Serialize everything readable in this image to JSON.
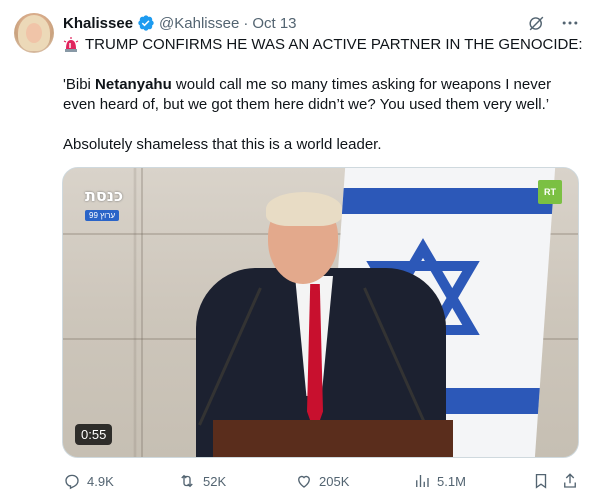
{
  "author": {
    "name": "Khalissee",
    "handle": "@Kahlissee",
    "separator": "·",
    "date": "Oct 13"
  },
  "tweet": {
    "headline": "TRUMP CONFIRMS HE WAS AN ACTIVE PARTNER IN THE GENOCIDE:",
    "quote_pre": "'Bibi ",
    "quote_bold": "Netanyahu",
    "quote_post": " would call me so many times asking for weapons I never even heard of, but we got them here didn’t we? You used them very well.’",
    "comment": "Absolutely shameless that this is a world leader."
  },
  "media": {
    "duration": "0:55",
    "channel_logo_text": "כנסת",
    "channel_number": "ערוץ 99",
    "rt_logo": "RT"
  },
  "actions": {
    "replies": "4.9K",
    "reposts": "52K",
    "likes": "205K",
    "views": "5.1M"
  },
  "colors": {
    "text": "#0f1419",
    "secondary": "#536471",
    "verified": "#1d9bf0",
    "siren": "#e0245e"
  }
}
